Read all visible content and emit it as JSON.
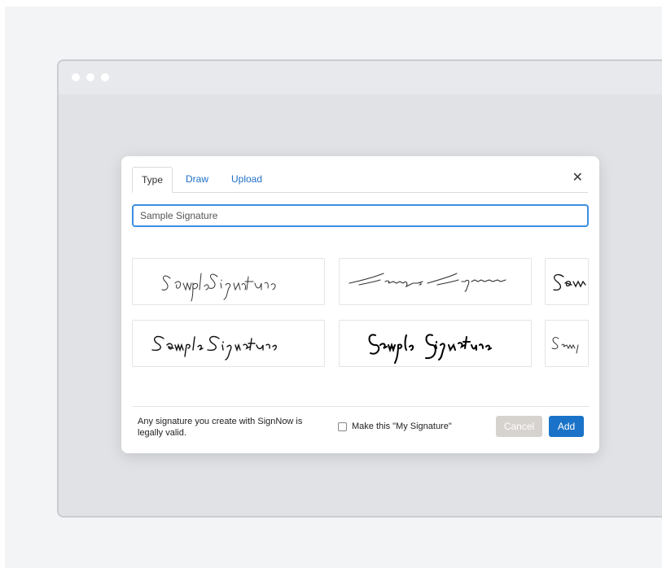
{
  "dialog": {
    "tabs": [
      {
        "label": "Type",
        "active": true
      },
      {
        "label": "Draw",
        "active": false
      },
      {
        "label": "Upload",
        "active": false
      }
    ],
    "close_icon": "close-icon",
    "input": {
      "value": "Sample Signature",
      "placeholder": "Sample Signature"
    },
    "signature_styles": [
      {
        "style": "script-light"
      },
      {
        "style": "script-slanted-thin"
      },
      {
        "style": "script-partial"
      },
      {
        "style": "script-print"
      },
      {
        "style": "script-bold"
      },
      {
        "style": "script-partial-2"
      }
    ],
    "legal_text": "Any signature you create with SignNow is legally valid.",
    "checkbox_label": "Make this \"My Signature\"",
    "checkbox_checked": false,
    "cancel_label": "Cancel",
    "add_label": "Add"
  },
  "colors": {
    "accent": "#1a73c8",
    "cancel_bg": "#d6d2ce",
    "input_border": "#3d8fe0"
  }
}
